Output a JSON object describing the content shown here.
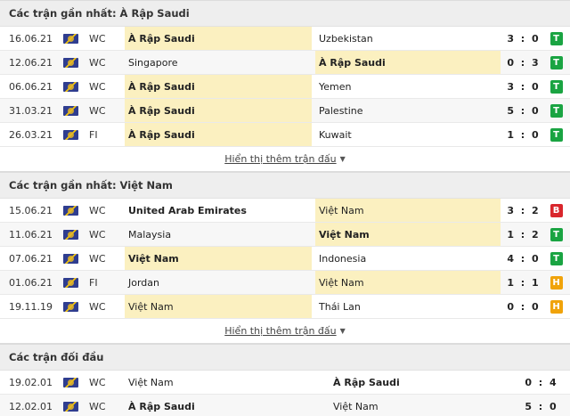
{
  "sections": [
    {
      "title": "Các trận gần nhất: À Rập Saudi",
      "more_label": "Hiển thị thêm trận đấu",
      "matches": [
        {
          "date": "16.06.21",
          "comp": "WC",
          "home": "À Rập Saudi",
          "away": "Uzbekistan",
          "score": "3 : 0",
          "result": "T",
          "result_color": "#1aa442",
          "hl": "home"
        },
        {
          "date": "12.06.21",
          "comp": "WC",
          "home": "Singapore",
          "away": "À Rập Saudi",
          "score": "0 : 3",
          "result": "T",
          "result_color": "#1aa442",
          "hl": "away"
        },
        {
          "date": "06.06.21",
          "comp": "WC",
          "home": "À Rập Saudi",
          "away": "Yemen",
          "score": "3 : 0",
          "result": "T",
          "result_color": "#1aa442",
          "hl": "home"
        },
        {
          "date": "31.03.21",
          "comp": "WC",
          "home": "À Rập Saudi",
          "away": "Palestine",
          "score": "5 : 0",
          "result": "T",
          "result_color": "#1aa442",
          "hl": "home"
        },
        {
          "date": "26.03.21",
          "comp": "FI",
          "home": "À Rập Saudi",
          "away": "Kuwait",
          "score": "1 : 0",
          "result": "T",
          "result_color": "#1aa442",
          "hl": "home"
        }
      ]
    },
    {
      "title": "Các trận gần nhất: Việt Nam",
      "more_label": "Hiển thị thêm trận đấu",
      "matches": [
        {
          "date": "15.06.21",
          "comp": "WC",
          "home": "United Arab Emirates",
          "away": "Việt Nam",
          "score": "3 : 2",
          "result": "B",
          "result_color": "#d9262c",
          "hl": "away"
        },
        {
          "date": "11.06.21",
          "comp": "WC",
          "home": "Malaysia",
          "away": "Việt Nam",
          "score": "1 : 2",
          "result": "T",
          "result_color": "#1aa442",
          "hl": "away"
        },
        {
          "date": "07.06.21",
          "comp": "WC",
          "home": "Việt Nam",
          "away": "Indonesia",
          "score": "4 : 0",
          "result": "T",
          "result_color": "#1aa442",
          "hl": "home"
        },
        {
          "date": "01.06.21",
          "comp": "FI",
          "home": "Jordan",
          "away": "Việt Nam",
          "score": "1 : 1",
          "result": "H",
          "result_color": "#f0a30a",
          "hl": "away"
        },
        {
          "date": "19.11.19",
          "comp": "WC",
          "home": "Việt Nam",
          "away": "Thái Lan",
          "score": "0 : 0",
          "result": "H",
          "result_color": "#f0a30a",
          "hl": "home"
        }
      ]
    },
    {
      "title": "Các trận đối đầu",
      "matches": [
        {
          "date": "19.02.01",
          "comp": "WC",
          "home": "Việt Nam",
          "away": "À Rập Saudi",
          "score": "0 : 4"
        },
        {
          "date": "12.02.01",
          "comp": "WC",
          "home": "À Rập Saudi",
          "away": "Việt Nam",
          "score": "5 : 0"
        }
      ]
    }
  ]
}
